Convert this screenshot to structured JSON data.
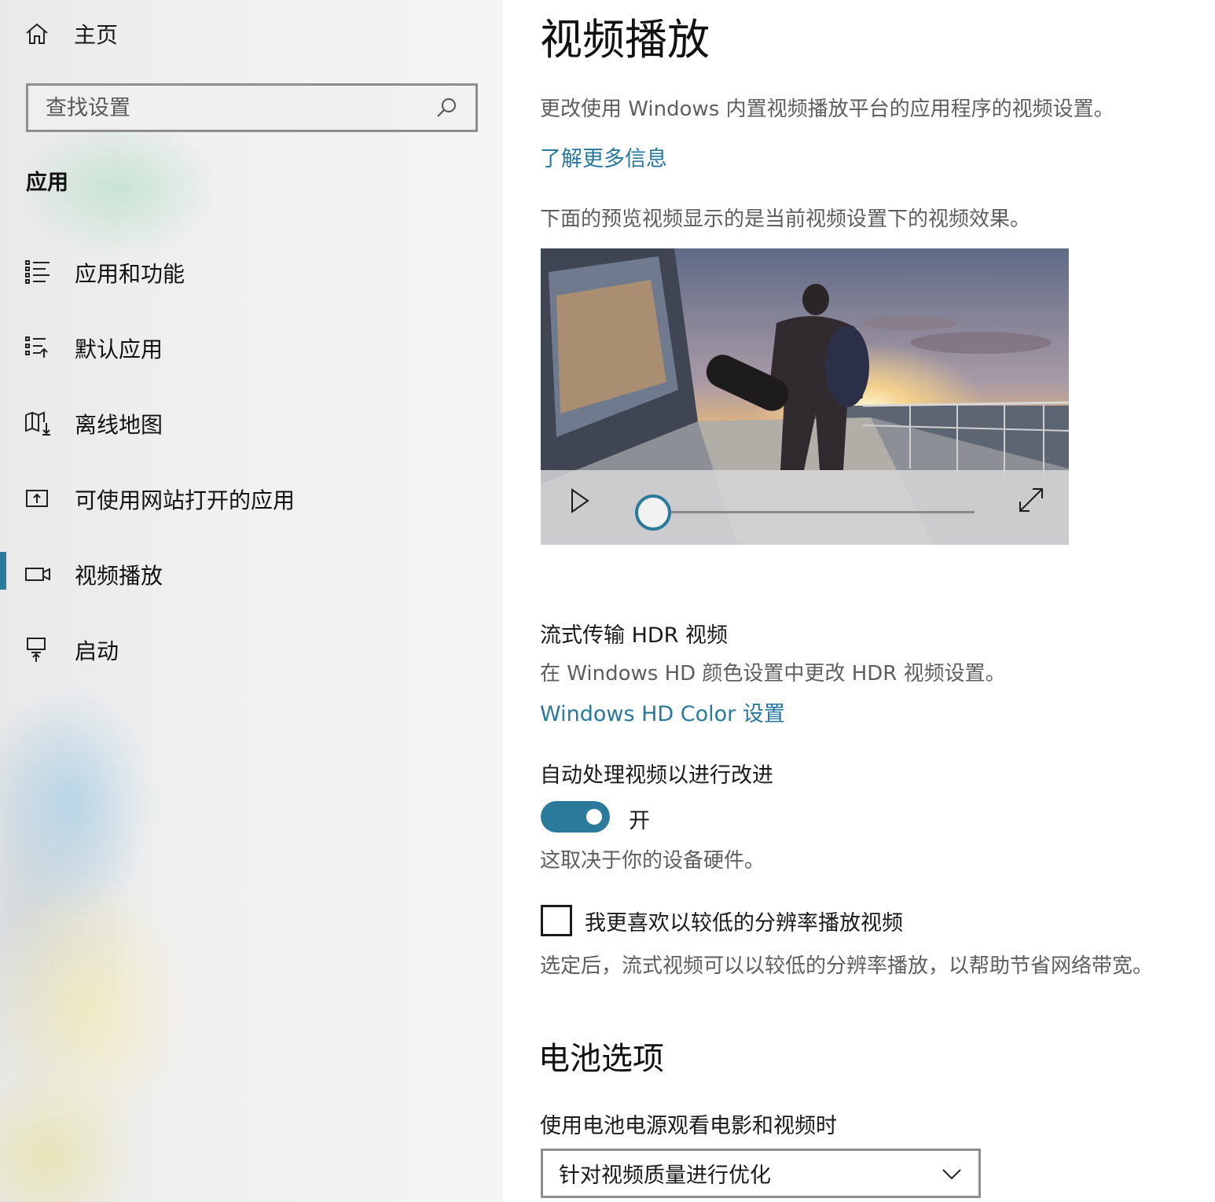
{
  "sidebar": {
    "home_label": "主页",
    "search": {
      "placeholder": "查找设置"
    },
    "section_label": "应用",
    "items": [
      {
        "label": "应用和功能",
        "icon": "apps-features-icon"
      },
      {
        "label": "默认应用",
        "icon": "default-apps-icon"
      },
      {
        "label": "离线地图",
        "icon": "offline-maps-icon"
      },
      {
        "label": "可使用网站打开的应用",
        "icon": "apps-for-websites-icon"
      },
      {
        "label": "视频播放",
        "icon": "video-playback-icon",
        "active": true
      },
      {
        "label": "启动",
        "icon": "startup-icon"
      }
    ]
  },
  "main": {
    "title": "视频播放",
    "description": "更改使用 Windows 内置视频播放平台的应用程序的视频设置。",
    "learn_more": "了解更多信息",
    "preview_note": "下面的预览视频显示的是当前视频设置下的视频效果。",
    "video": {
      "progress": 0.0
    },
    "hdr": {
      "heading": "流式传输 HDR 视频",
      "description": "在 Windows HD 颜色设置中更改 HDR 视频设置。",
      "link": "Windows HD Color 设置"
    },
    "auto_process": {
      "heading": "自动处理视频以进行改进",
      "toggle_state": "开",
      "note": "这取决于你的设备硬件。"
    },
    "low_resolution": {
      "label": "我更喜欢以较低的分辨率播放视频",
      "checked": false,
      "note": "选定后，流式视频可以以较低的分辨率播放，以帮助节省网络带宽。"
    },
    "battery": {
      "title": "电池选项",
      "label": "使用电池电源观看电影和视频时",
      "dropdown_value": "针对视频质量进行优化"
    }
  },
  "colors": {
    "accent": "#2b7a9b",
    "link": "#2878a0"
  }
}
